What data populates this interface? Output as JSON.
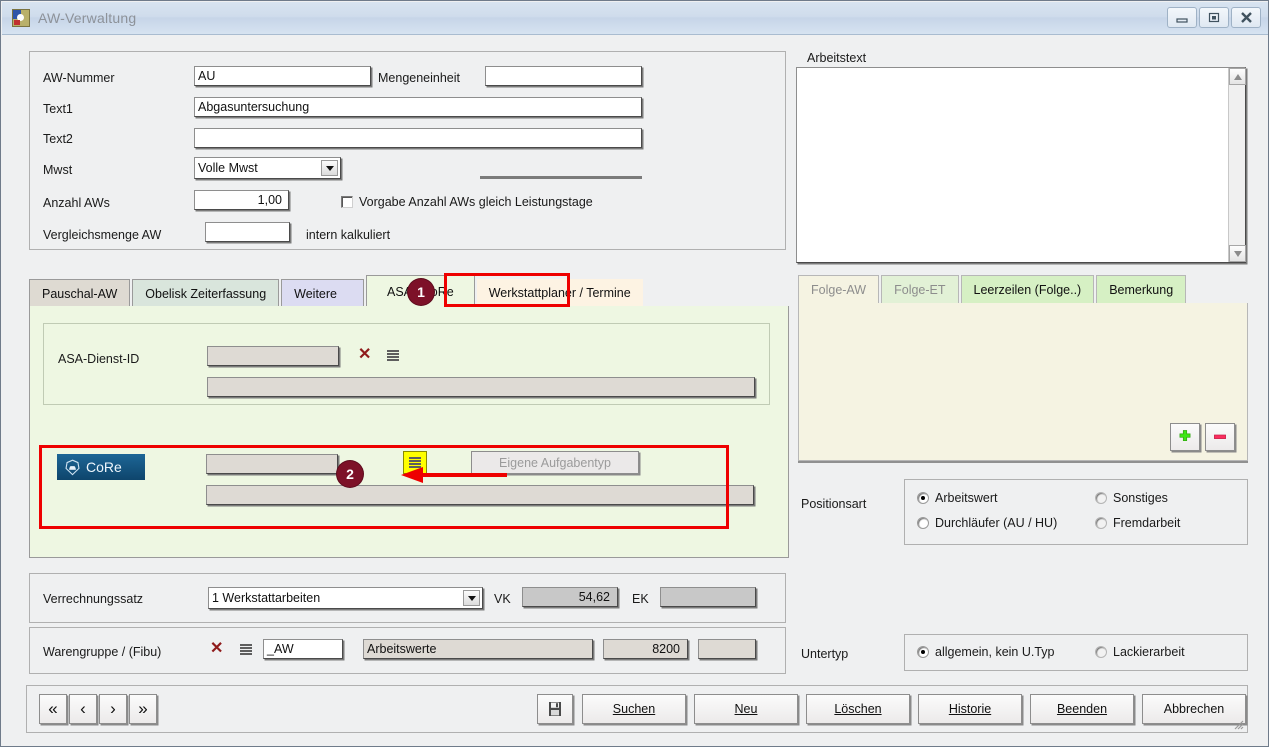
{
  "window": {
    "title": "AW-Verwaltung",
    "icon": "app-icon",
    "minimize": "minimize-icon",
    "maximize": "maximize-icon",
    "close": "close-icon"
  },
  "form": {
    "aw_nummer_label": "AW-Nummer",
    "aw_nummer_value": "AU",
    "mengeneinheit_label": "Mengeneinheit",
    "mengeneinheit_value": "",
    "text1_label": "Text1",
    "text1_value": "Abgasuntersuchung",
    "text2_label": "Text2",
    "text2_value": "",
    "mwst_label": "Mwst",
    "mwst_value": "Volle Mwst",
    "mwst_options": [
      "Volle Mwst"
    ],
    "anzahl_aws_label": "Anzahl AWs",
    "anzahl_aws_value": "1,00",
    "vorgabe_checkbox_label": "Vorgabe Anzahl AWs gleich Leistungstage",
    "vorgabe_checked": false,
    "vergleichsmenge_label": "Vergleichsmenge AW",
    "vergleichsmenge_value": "",
    "intern_kalkuliert_label": "intern kalkuliert"
  },
  "left_tabs": {
    "items": [
      {
        "label": "Pauschal-AW",
        "state": "normal",
        "color": "#dedad2"
      },
      {
        "label": "Obelisk Zeiterfassung",
        "state": "normal",
        "color": "#d9e5dc"
      },
      {
        "label": "Weitere",
        "state": "normal",
        "color": "#dcdcf2"
      },
      {
        "label": "ASA / CoRe",
        "state": "selected",
        "color": "#eef7e2"
      },
      {
        "label": "Werkstattplaner / Termine",
        "state": "normal",
        "color": "#fdf3e3"
      }
    ]
  },
  "asa_panel": {
    "asa_dienst_id_label": "ASA-Dienst-ID",
    "asa_dienst_id_value": "",
    "asa_clear_icon": "x-clear-icon",
    "asa_list_icon": "list-icon",
    "asa_desc_value": "",
    "core_logo_text": "CoRe",
    "core_logo_icon": "core-shield-car-icon",
    "core_value": "",
    "core_list_icon": "list-icon",
    "core_desc_value": "",
    "eigene_aufgabentyp_label": "Eigene Aufgabentyp",
    "eigene_aufgabentyp_disabled": true
  },
  "callouts": [
    {
      "number": "1",
      "target": "tab ASA / CoRe"
    },
    {
      "number": "2",
      "target": "core list button"
    }
  ],
  "verrechnung": {
    "label": "Verrechnungssatz",
    "value": "1 Werkstattarbeiten",
    "options": [
      "1 Werkstattarbeiten"
    ],
    "vk_label": "VK",
    "vk_value": "54,62",
    "ek_label": "EK",
    "ek_value": ""
  },
  "warengruppe": {
    "label": "Warengruppe / (Fibu)",
    "clear_icon": "x-clear-icon",
    "list_icon": "list-icon",
    "code_value": "_AW",
    "name_value": "Arbeitswerte",
    "fibu_value": "8200",
    "extra_value": ""
  },
  "arbeitstext": {
    "label": "Arbeitstext",
    "value": "",
    "scroll_up_icon": "scroll-up-icon",
    "scroll_down_icon": "scroll-down-icon"
  },
  "right_tabs": {
    "items": [
      {
        "label": "Folge-AW",
        "state": "selected"
      },
      {
        "label": "Folge-ET",
        "state": "disabled"
      },
      {
        "label": "Leerzeilen (Folge..)",
        "state": "normal"
      },
      {
        "label": "Bemerkung",
        "state": "normal"
      }
    ],
    "add_icon": "plus-icon",
    "remove_icon": "minus-icon"
  },
  "positionsart": {
    "label": "Positionsart",
    "options": [
      {
        "label": "Arbeitswert",
        "checked": true,
        "dim": false
      },
      {
        "label": "Sonstiges",
        "checked": false,
        "dim": true
      },
      {
        "label": "Durchläufer (AU / HU)",
        "checked": false,
        "dim": false
      },
      {
        "label": "Fremdarbeit",
        "checked": false,
        "dim": true
      }
    ]
  },
  "untertyp": {
    "label": "Untertyp",
    "options": [
      {
        "label": "allgemein, kein U.Typ",
        "checked": true
      },
      {
        "label": "Lackierarbeit",
        "checked": false
      }
    ]
  },
  "bottom_bar": {
    "nav": [
      {
        "icon": "first-record-icon",
        "glyph": "«"
      },
      {
        "icon": "prev-record-icon",
        "glyph": "‹"
      },
      {
        "icon": "next-record-icon",
        "glyph": "›"
      },
      {
        "icon": "last-record-icon",
        "glyph": "»"
      }
    ],
    "save_icon": "save-disk-icon",
    "buttons": [
      {
        "label": "Suchen",
        "accel": "S"
      },
      {
        "label": "Neu",
        "accel": "N"
      },
      {
        "label": "Löschen",
        "accel": "L"
      },
      {
        "label": "Historie",
        "accel": "H"
      },
      {
        "label": "Beenden",
        "accel": "B"
      },
      {
        "label": "Abbrechen",
        "accel": ""
      }
    ]
  },
  "colors": {
    "accent_red": "#ee0000",
    "badge": "#7d1128",
    "core_blue": "#12537f",
    "highlight_yellow": "#ffff00",
    "panel_green": "#eef7e2",
    "tab_cream": "#f5f3e2"
  }
}
